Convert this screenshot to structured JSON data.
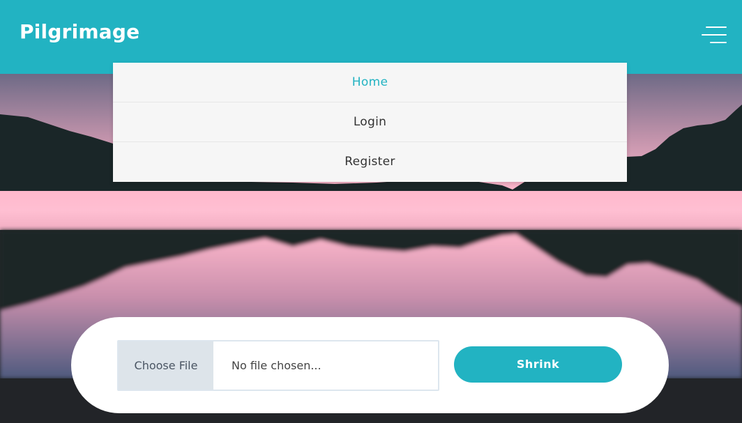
{
  "navbar": {
    "brand": "Pilgrimage",
    "menu_icon": "hamburger-menu-icon",
    "background_color": "#22b3c2"
  },
  "menu": {
    "items": [
      {
        "label": "Home",
        "active": true
      },
      {
        "label": "Login",
        "active": false
      },
      {
        "label": "Register",
        "active": false
      }
    ],
    "active_color": "#22b3c2"
  },
  "upload": {
    "choose_file_label": "Choose File",
    "file_status": "No file chosen...",
    "submit_label": "Shrink"
  },
  "colors": {
    "accent": "#22b3c2",
    "mountain_dark": "#1a2628",
    "sky_pink": "#ffb8cc",
    "bottom_bar": "#222428"
  }
}
